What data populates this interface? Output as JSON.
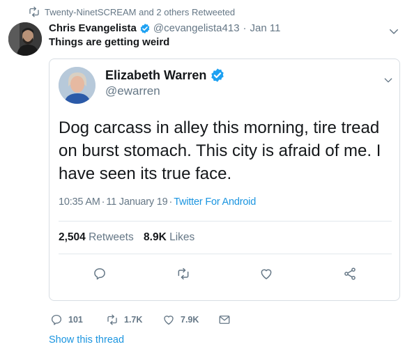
{
  "context": {
    "text": "Twenty-NinetSCREAM and 2 others Retweeted",
    "icon": "retweet-icon"
  },
  "outer_tweet": {
    "name": "Chris Evangelista",
    "handle": "@cevangelista413",
    "separator": "·",
    "time": "Jan 11",
    "text": "Things are getting weird",
    "verified": true
  },
  "quoted_tweet": {
    "name": "Elizabeth Warren",
    "handle": "@ewarren",
    "verified": true,
    "text": "Dog carcass in alley this morning, tire tread on burst stomach. This city is afraid of me. I have seen its true face.",
    "time": "10:35 AM",
    "date": "11 January 19",
    "sep": "·",
    "source": "Twitter For Android",
    "retweets_count": "2,504",
    "retweets_label": "Retweets",
    "likes_count": "8.9K",
    "likes_label": "Likes"
  },
  "outer_actions": {
    "replies": "101",
    "retweets": "1.7K",
    "likes": "7.9K"
  },
  "show_thread": "Show this thread",
  "colors": {
    "accent": "#1b95e0",
    "muted": "#657786",
    "text": "#14171a",
    "border": "#d7dde3"
  }
}
